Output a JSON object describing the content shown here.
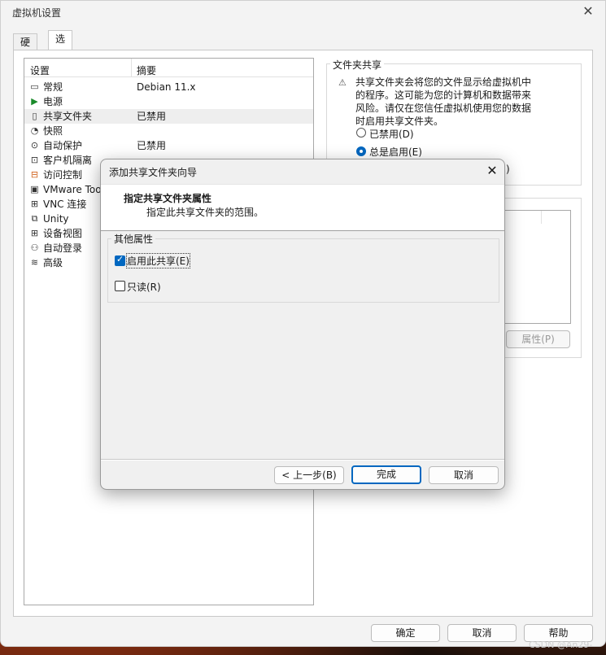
{
  "window": {
    "title": "虚拟机设置"
  },
  "tabs": [
    {
      "label": "硬件"
    },
    {
      "label": "选项"
    }
  ],
  "list": {
    "headers": {
      "setting": "设置",
      "summary": "摘要"
    },
    "rows": [
      {
        "icon": "monitor-icon",
        "glyph": "▭",
        "label": "常规",
        "summary": "Debian 11.x"
      },
      {
        "icon": "power-icon",
        "glyph": "▶",
        "label": "电源",
        "summary": ""
      },
      {
        "icon": "shared-folder-icon",
        "glyph": "▯",
        "label": "共享文件夹",
        "summary": "已禁用"
      },
      {
        "icon": "snapshot-icon",
        "glyph": "◔",
        "label": "快照",
        "summary": ""
      },
      {
        "icon": "autoprotect-icon",
        "glyph": "⊙",
        "label": "自动保护",
        "summary": "已禁用"
      },
      {
        "icon": "isolation-icon",
        "glyph": "⊡",
        "label": "客户机隔离",
        "summary": ""
      },
      {
        "icon": "lock-icon",
        "glyph": "⊟",
        "label": "访问控制",
        "summary": ""
      },
      {
        "icon": "vmware-tools-icon",
        "glyph": "▣",
        "label": "VMware Too",
        "summary": ""
      },
      {
        "icon": "vnc-icon",
        "glyph": "⊞",
        "label": "VNC 连接",
        "summary": ""
      },
      {
        "icon": "unity-icon",
        "glyph": "⧉",
        "label": "Unity",
        "summary": ""
      },
      {
        "icon": "device-view-icon",
        "glyph": "⊞",
        "label": "设备视图",
        "summary": ""
      },
      {
        "icon": "autologin-icon",
        "glyph": "⚇",
        "label": "自动登录",
        "summary": ""
      },
      {
        "icon": "advanced-icon",
        "glyph": "≋",
        "label": "高级",
        "summary": ""
      }
    ]
  },
  "folder_sharing": {
    "title": "文件夹共享",
    "warning": "共享文件夹会将您的文件显示给虚拟机中的程序。这可能为您的计算机和数据带来风险。请仅在您信任虚拟机使用您的数据时启用共享文件夹。",
    "options": [
      {
        "label": "已禁用(D)",
        "selected": false
      },
      {
        "label": "总是启用(E)",
        "selected": true
      },
      {
        "label": ")",
        "selected": false
      }
    ],
    "properties_button": "属性(P)"
  },
  "dialog": {
    "title": "添加共享文件夹向导",
    "heading": "指定共享文件夹属性",
    "subheading": "指定此共享文件夹的范围。",
    "group_title": "其他属性",
    "enable_share": {
      "label": "启用此共享(E)",
      "checked": true
    },
    "read_only": {
      "label": "只读(R)",
      "checked": false
    },
    "buttons": {
      "back": "< 上一步(B)",
      "finish": "完成",
      "cancel": "取消"
    }
  },
  "footer": {
    "ok": "确定",
    "cancel": "取消",
    "help": "帮助"
  },
  "watermark": "CSDN @An29-"
}
